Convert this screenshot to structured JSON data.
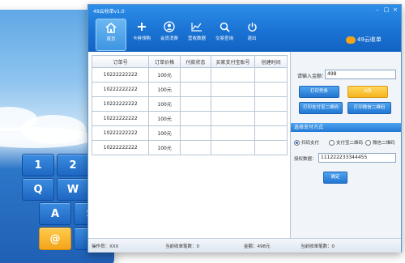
{
  "app": {
    "title": "49云收单v1.0"
  },
  "nav": {
    "items": [
      {
        "label": "首页"
      },
      {
        "label": "卡券领购"
      },
      {
        "label": "会员消费"
      },
      {
        "label": "营收数据"
      },
      {
        "label": "交易查询"
      },
      {
        "label": "退出"
      }
    ]
  },
  "brand": {
    "logo_text": "49云收单"
  },
  "table": {
    "headers": [
      "订单号",
      "订单价格",
      "付款状态",
      "买家支付宝账号",
      "创建时间"
    ],
    "rows": [
      [
        "10222222222",
        "100元",
        "",
        "",
        ""
      ],
      [
        "10222222222",
        "100元",
        "",
        "",
        ""
      ],
      [
        "10222222222",
        "100元",
        "",
        "",
        ""
      ],
      [
        "10222222222",
        "100元",
        "",
        "",
        ""
      ],
      [
        "10222222222",
        "100元",
        "",
        "",
        ""
      ],
      [
        "10222222222",
        "100元",
        "",
        "",
        ""
      ]
    ]
  },
  "right": {
    "amount_label": "请输入金额：",
    "amount_value": "498",
    "print_receipt": "打印凭条",
    "clear_btn": "6改",
    "print_qr": "打印支付宝二维码",
    "print_wx_qr": "打印微信二维码",
    "pay_section": "选择支付方式",
    "pay_options": [
      "扫码支付",
      "支付宝二维码",
      "微信二维码"
    ],
    "auth_label": "授权数据：",
    "auth_value": "111222233344455",
    "confirm_btn": "确定"
  },
  "status": {
    "operator": "操作员：XXX",
    "current_count": "当前收单笔数：0",
    "amount": "金额：498元",
    "current_count2": "当前收单笔数：0"
  },
  "keyboard": {
    "keys": [
      "1",
      "2",
      "Q",
      "W",
      "A",
      "S",
      "@",
      "."
    ]
  },
  "colors": {
    "accent": "#1a73d4",
    "button_yellow": "#f6b41f"
  }
}
